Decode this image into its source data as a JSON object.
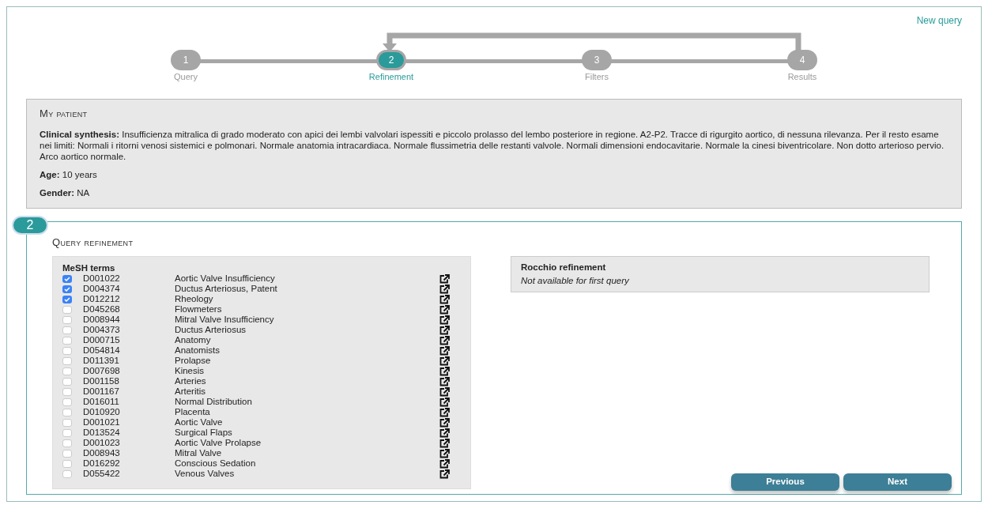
{
  "header": {
    "link": "New query"
  },
  "steps": [
    {
      "number": "1",
      "label": "Query",
      "selected": false
    },
    {
      "number": "2",
      "label": "Refinement",
      "selected": true
    },
    {
      "number": "3",
      "label": "Filters",
      "selected": false
    },
    {
      "number": "4",
      "label": "Results",
      "selected": false
    }
  ],
  "patient": {
    "title": "My patient",
    "fields": [
      {
        "label": "Clinical synthesis:",
        "value": "Insufficienza mitralica di grado moderato con apici dei lembi valvolari ispessiti e piccolo prolasso del lembo posteriore in regione. A2-P2. Tracce di rigurgito aortico, di nessuna rilevanza. Per il resto esame nei limiti: Normali i ritorni venosi sistemici e polmonari. Normale anatomia intracardiaca. Normale flussimetria delle restanti valvole. Normali dimensioni endocavitarie. Normale la cinesi biventricolare. Non dotto arterioso pervio. Arco aortico normale."
      },
      {
        "label": "Age:",
        "value": "10 years"
      },
      {
        "label": "Gender:",
        "value": "NA"
      }
    ]
  },
  "refinement": {
    "badge": "2",
    "title": "Query refinement",
    "terms_header": "MeSH terms",
    "terms": [
      {
        "code": "D001022",
        "name": "Aortic Valve Insufficiency",
        "checked": true
      },
      {
        "code": "D004374",
        "name": "Ductus Arteriosus, Patent",
        "checked": true
      },
      {
        "code": "D012212",
        "name": "Rheology",
        "checked": true
      },
      {
        "code": "D045268",
        "name": "Flowmeters",
        "checked": false
      },
      {
        "code": "D008944",
        "name": "Mitral Valve Insufficiency",
        "checked": false
      },
      {
        "code": "D004373",
        "name": "Ductus Arteriosus",
        "checked": false
      },
      {
        "code": "D000715",
        "name": "Anatomy",
        "checked": false
      },
      {
        "code": "D054814",
        "name": "Anatomists",
        "checked": false
      },
      {
        "code": "D011391",
        "name": "Prolapse",
        "checked": false
      },
      {
        "code": "D007698",
        "name": "Kinesis",
        "checked": false
      },
      {
        "code": "D001158",
        "name": "Arteries",
        "checked": false
      },
      {
        "code": "D001167",
        "name": "Arteritis",
        "checked": false
      },
      {
        "code": "D016011",
        "name": "Normal Distribution",
        "checked": false
      },
      {
        "code": "D010920",
        "name": "Placenta",
        "checked": false
      },
      {
        "code": "D001021",
        "name": "Aortic Valve",
        "checked": false
      },
      {
        "code": "D013524",
        "name": "Surgical Flaps",
        "checked": false
      },
      {
        "code": "D001023",
        "name": "Aortic Valve Prolapse",
        "checked": false
      },
      {
        "code": "D008943",
        "name": "Mitral Valve",
        "checked": false
      },
      {
        "code": "D016292",
        "name": "Conscious Sedation",
        "checked": false
      },
      {
        "code": "D055422",
        "name": "Venous Valves",
        "checked": false
      }
    ],
    "rocchio": {
      "title": "Rocchio refinement",
      "note": "Not available for first query"
    }
  },
  "buttons": [
    "Previous",
    "Next"
  ]
}
